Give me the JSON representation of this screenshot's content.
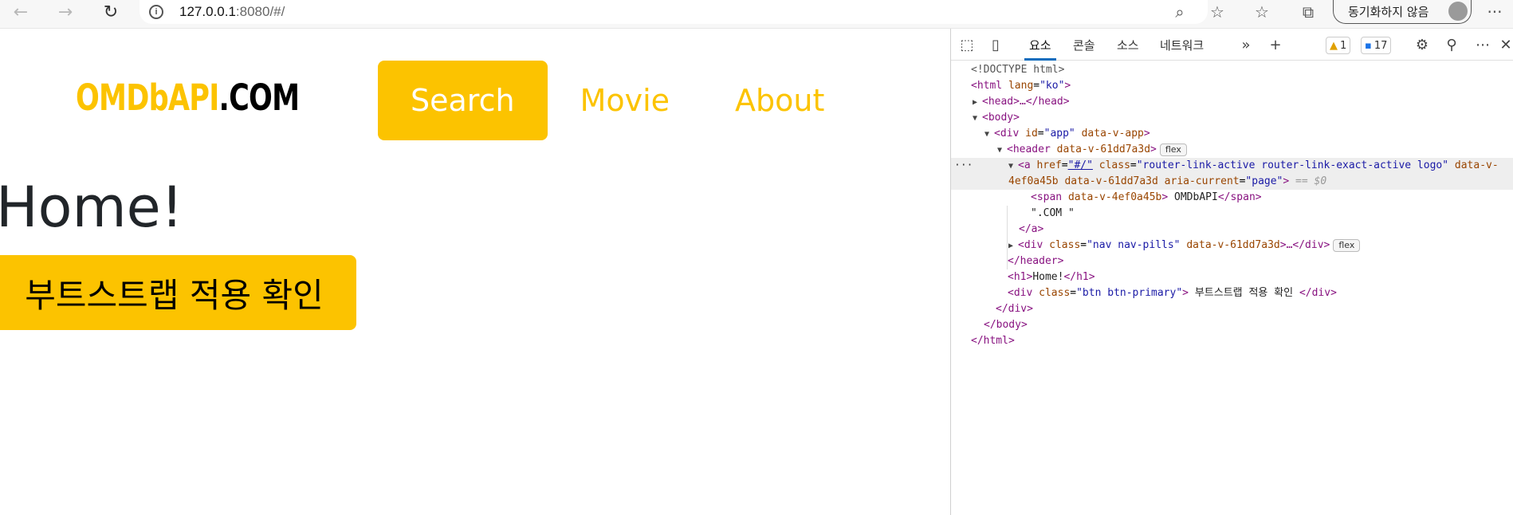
{
  "browser": {
    "url_host": "127.0.0.1",
    "url_rest": ":8080/#/",
    "sync_label": "동기화하지 않음"
  },
  "page": {
    "logo_brand": "OMDbAPI",
    "logo_suffix": ".COM",
    "nav": [
      {
        "label": "Search",
        "active": true
      },
      {
        "label": "Movie",
        "active": false
      },
      {
        "label": "About",
        "active": false
      }
    ],
    "heading": "Home!",
    "button_label": "부트스트랩 적용 확인"
  },
  "devtools": {
    "tabs": [
      "요소",
      "콘솔",
      "소스",
      "네트워크"
    ],
    "warnings": "1",
    "messages": "17",
    "flex_label": "flex",
    "dom": {
      "doctype": "<!DOCTYPE html>",
      "html_open_tag": "<html",
      "html_lang_attr": "lang",
      "html_lang_val": "\"ko\"",
      "head": "<head>…</head>",
      "body_open": "<body>",
      "div_app_tag": "<div",
      "div_app_id_attr": "id",
      "div_app_id_val": "\"app\"",
      "div_app_extra": "data-v-app",
      "header_tag": "<header",
      "header_attr": "data-v-61dd7a3d",
      "a_tag": "<a",
      "a_href_attr": "href",
      "a_href_val": "\"#/\"",
      "a_class_attr": "class",
      "a_class_val": "\"router-link-active router-link-exact-active logo\"",
      "a_data_attr": "data-v-",
      "a_line2_attr1": "4ef0a45b data-v-61dd7a3d",
      "a_aria_attr": "aria-current",
      "a_aria_val": "\"page\"",
      "a_eq": "== $0",
      "span_open": "<span",
      "span_attr": "data-v-4ef0a45b",
      "span_text": "OMDbAPI",
      "span_close": "</span>",
      "com_text": "\".COM \"",
      "a_close": "</a>",
      "nav_tag": "<div",
      "nav_class_attr": "class",
      "nav_class_val": "\"nav nav-pills\"",
      "nav_data_attr": "data-v-61dd7a3d",
      "nav_tail": "…</div>",
      "header_close": "</header>",
      "h1_open": "<h1>",
      "h1_text": "Home!",
      "h1_close": "</h1>",
      "btn_tag": "<div",
      "btn_class_attr": "class",
      "btn_class_val": "\"btn btn-primary\"",
      "btn_text": " 부트스트랩 적용 확인 ",
      "btn_close": "</div>",
      "div_close": "</div>",
      "body_close": "</body>",
      "html_close": "</html>",
      "ellipsis": "···"
    }
  },
  "colors": {
    "accent": "#fcc300",
    "selection": "#0f6cbd"
  }
}
